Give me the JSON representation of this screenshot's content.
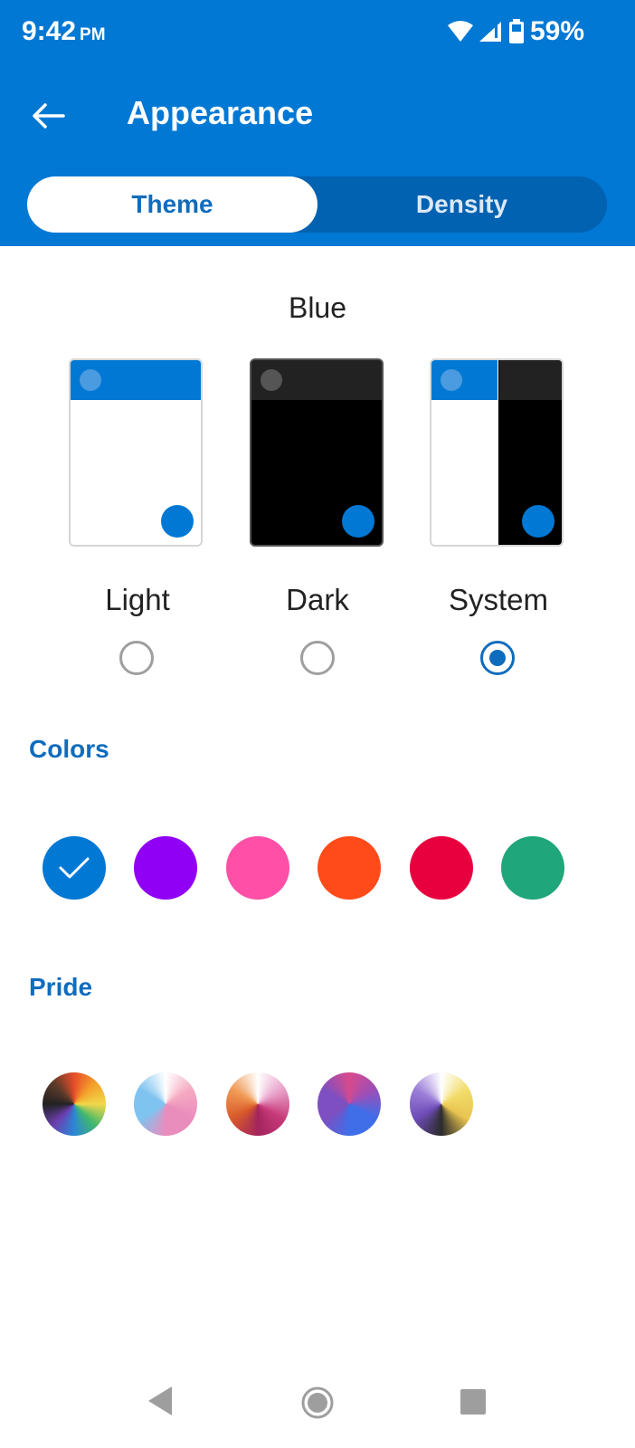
{
  "status_bar": {
    "time": "9:42",
    "ampm": "PM",
    "battery": "59%"
  },
  "header": {
    "title": "Appearance",
    "back_icon": "arrow-left-icon"
  },
  "tabs": [
    {
      "label": "Theme",
      "selected": true
    },
    {
      "label": "Density",
      "selected": false
    }
  ],
  "theme": {
    "current_color_name": "Blue",
    "options": [
      {
        "label": "Light",
        "selected": false
      },
      {
        "label": "Dark",
        "selected": false
      },
      {
        "label": "System",
        "selected": true
      }
    ]
  },
  "colors": {
    "title": "Colors",
    "swatches": [
      {
        "name": "blue",
        "color": "#0078d4",
        "selected": true
      },
      {
        "name": "purple",
        "color": "#8f00f5"
      },
      {
        "name": "pink",
        "color": "#ff4fa7"
      },
      {
        "name": "orange",
        "color": "#ff4a1a"
      },
      {
        "name": "red",
        "color": "#e8003e"
      },
      {
        "name": "green",
        "color": "#1fa67a"
      }
    ]
  },
  "pride": {
    "title": "Pride",
    "swatches": [
      {
        "name": "rainbow",
        "gradient": "conic-gradient(from 0deg, #e64d2a, #f4a12b, #f1d74a, #40b86b, #2b86d6, #6b3fb0, #222, #5a3a2a, #e64d2a)"
      },
      {
        "name": "trans",
        "gradient": "conic-gradient(from 0deg, #ffffff, #f5a9c0, #e98dbd, #e98dbd, #7fc3f0, #7fc3f0, #ffffff)"
      },
      {
        "name": "lesbian",
        "gradient": "conic-gradient(from 0deg, #ffffff, #e8a0c8, #c83a7a, #a3245c, #d85a2a, #f09a55, #ffffff)"
      },
      {
        "name": "bisexual",
        "gradient": "conic-gradient(from 0deg, #d94a8c, #9b4fb8, #3f6ee8, #3f6ee8, #7e4fc0, #7e4fc0, #d94a8c)"
      },
      {
        "name": "nonbinary",
        "gradient": "conic-gradient(from 0deg, #ffffff, #f2dc6b, #e9c450, #2b2b2b, #6e4cb8, #9c7fd8, #ffffff)"
      }
    ]
  },
  "nav_bar": {
    "back": "back-triangle-icon",
    "home": "home-circle-icon",
    "recents": "recents-square-icon"
  }
}
